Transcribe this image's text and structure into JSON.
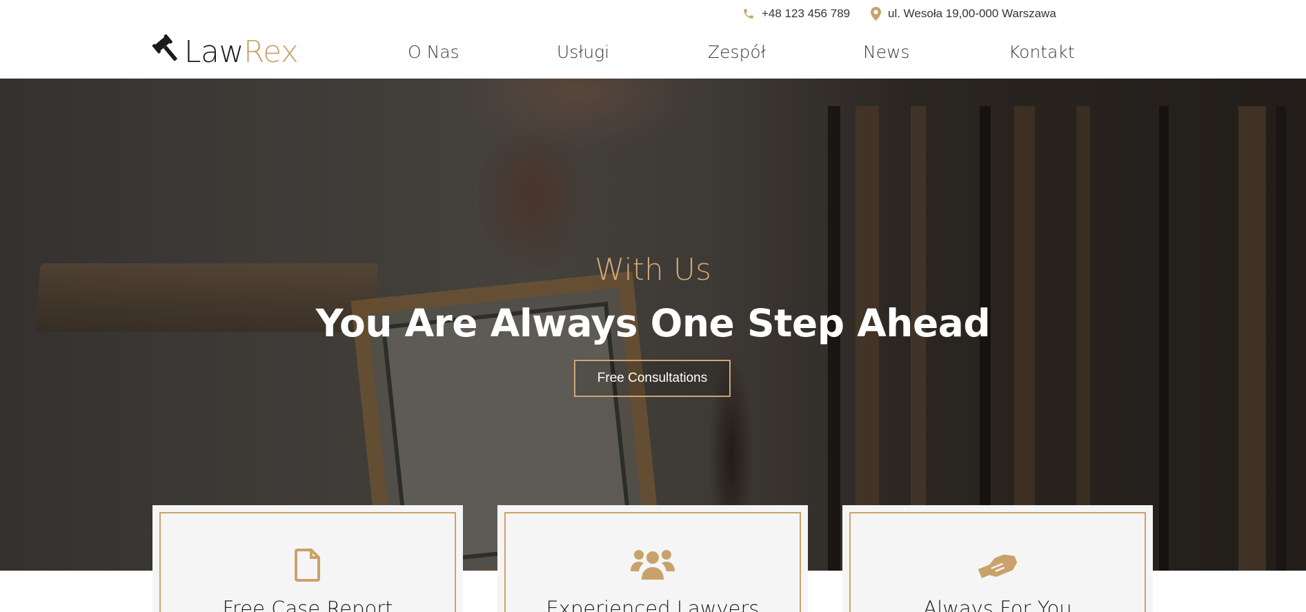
{
  "contact": {
    "phone": "+48 123 456 789",
    "phone_icon": "phone-icon",
    "address": "ul. Wesoła 19,00-000 Warszawa",
    "address_icon": "map-pin-icon"
  },
  "brand": {
    "logo_icon": "gavel-icon",
    "name_part1": "Law",
    "name_part2": "Rex"
  },
  "nav": {
    "items": [
      {
        "label": "O Nas"
      },
      {
        "label": "Usługi"
      },
      {
        "label": "Zespół"
      },
      {
        "label": "News"
      },
      {
        "label": "Kontakt"
      }
    ]
  },
  "hero": {
    "subtitle": "With Us",
    "title": "You Are Always One Step Ahead",
    "cta_label": "Free Consultations"
  },
  "features": [
    {
      "title": "Free Case Report",
      "icon": "document-icon"
    },
    {
      "title": "Experienced Lawyers",
      "icon": "users-icon"
    },
    {
      "title": "Always For You",
      "icon": "handshake-icon"
    }
  ],
  "colors": {
    "accent": "#c9a26b",
    "text": "#1b1b1b",
    "card_bg": "#f5f5f5"
  }
}
